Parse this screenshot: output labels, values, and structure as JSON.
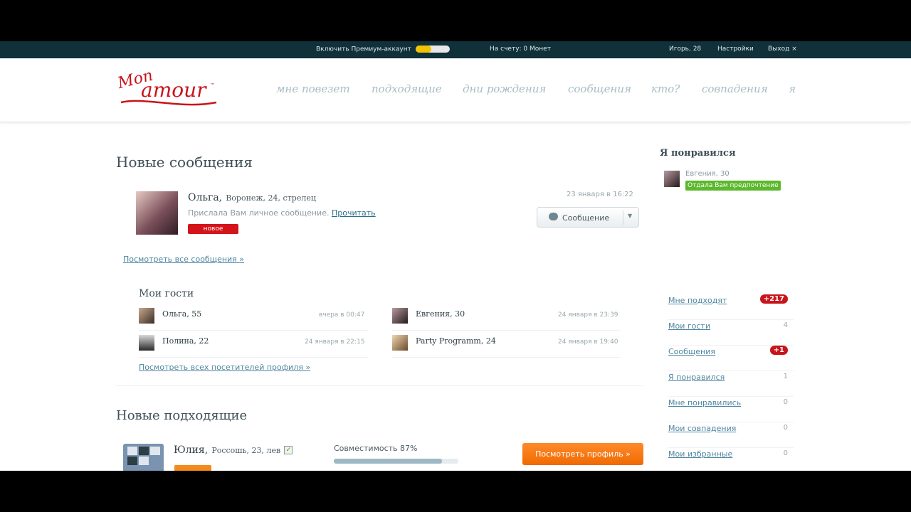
{
  "topbar": {
    "premium_label": "Включить Премиум-аккаунт",
    "balance": "На счету: 0 Монет",
    "user": "Игорь, 28",
    "settings": "Настройки",
    "logout": "Выход ×"
  },
  "header": {
    "logo_text_top": "Mon",
    "logo_text_bottom": "amour",
    "nav": [
      "мне повезет",
      "подходящие",
      "дни рождения",
      "сообщения",
      "кто?",
      "совпадения",
      "я"
    ]
  },
  "messages": {
    "title": "Новые сообщения",
    "item": {
      "name": "Ольга,",
      "details": "Воронеж, 24, стрелец",
      "text": "Прислала Вам личное сообщение.",
      "read_link": "Прочитать",
      "badge": "новое",
      "time": "23 января в 16:22"
    },
    "button_label": "Сообщение",
    "view_all": "Посмотреть все сообщения",
    "view_all_arrow": "»"
  },
  "guests": {
    "title": "Мои гости",
    "items": [
      {
        "name": "Ольга, 55",
        "time": "вчера в 00:47"
      },
      {
        "name": "Евгения, 30",
        "time": "24 января в 23:39"
      },
      {
        "name": "Полина, 22",
        "time": "24 января в 22:15"
      },
      {
        "name": "Party Programm, 24",
        "time": "24 января в 19:40"
      }
    ],
    "view_all": "Посмотреть всех посетителей профиля",
    "view_all_arrow": "»"
  },
  "matches": {
    "title": "Новые подходящие",
    "item": {
      "name": "Юлия,",
      "details": "Россошь, 23, лев",
      "compat_label": "Совместимость 87%",
      "compat_value": 0.87,
      "button": "Посмотреть профиль »"
    }
  },
  "sidebar": {
    "liked_title": "Я понравился",
    "liked_item": {
      "name": "Евгения, 30",
      "badge": "Отдала Вам предпочтение"
    },
    "items": [
      {
        "label": "Мне подходят",
        "count": "+217",
        "highlight": true
      },
      {
        "label": "Мои гости",
        "count": "4",
        "highlight": false
      },
      {
        "label": "Сообщения",
        "count": "+1",
        "highlight": true
      },
      {
        "label": "Я понравился",
        "count": "1",
        "highlight": false
      },
      {
        "label": "Мне понравились",
        "count": "0",
        "highlight": false
      },
      {
        "label": "Мои совпадения",
        "count": "0",
        "highlight": false
      },
      {
        "label": "Мои избранные",
        "count": "0",
        "highlight": false
      }
    ]
  },
  "colors": {
    "topbar": "#10303a",
    "brand_red": "#c8141a",
    "accent_orange": "#f07a10",
    "green_badge": "#5cb82c"
  }
}
